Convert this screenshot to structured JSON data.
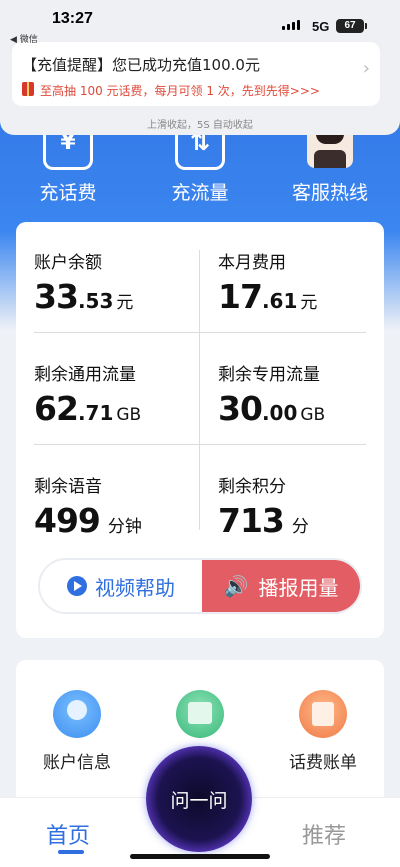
{
  "status_bar": {
    "time": "13:27",
    "back_label": "◀ 微信",
    "network": "5G",
    "battery": "67"
  },
  "notification": {
    "title": "【充值提醒】您已成功充值100.0元",
    "subtitle": "至高抽 100 元话费，每月可领 1 次，先到先得>>>",
    "hint": "上滑收起，5S 自动收起"
  },
  "top_actions": [
    {
      "label": "充话费",
      "icon": "yuan-icon"
    },
    {
      "label": "充流量",
      "icon": "data-transfer-icon"
    },
    {
      "label": "客服热线",
      "icon": "customer-service-icon"
    }
  ],
  "balance": {
    "account_balance": {
      "label": "账户余额",
      "int": "33",
      "dec": ".53",
      "unit": "元"
    },
    "month_fee": {
      "label": "本月费用",
      "int": "17",
      "dec": ".61",
      "unit": "元"
    },
    "general_data": {
      "label": "剩余通用流量",
      "int": "62",
      "dec": ".71",
      "unit": "GB"
    },
    "special_data": {
      "label": "剩余专用流量",
      "int": "30",
      "dec": ".00",
      "unit": "GB"
    },
    "voice": {
      "label": "剩余语音",
      "int": "499",
      "unit": "分钟"
    },
    "points": {
      "label": "剩余积分",
      "int": "713",
      "unit": "分"
    }
  },
  "buttons": {
    "video_help": "视频帮助",
    "report_usage": "播报用量"
  },
  "services": [
    {
      "label": "账户信息"
    },
    {
      "label": ""
    },
    {
      "label": "话费账单"
    }
  ],
  "ask_button": "问一问",
  "nav": {
    "home": "首页",
    "recommend": "推荐"
  },
  "colors": {
    "brand_blue": "#2f6fe0",
    "report_red": "#e35d64"
  }
}
